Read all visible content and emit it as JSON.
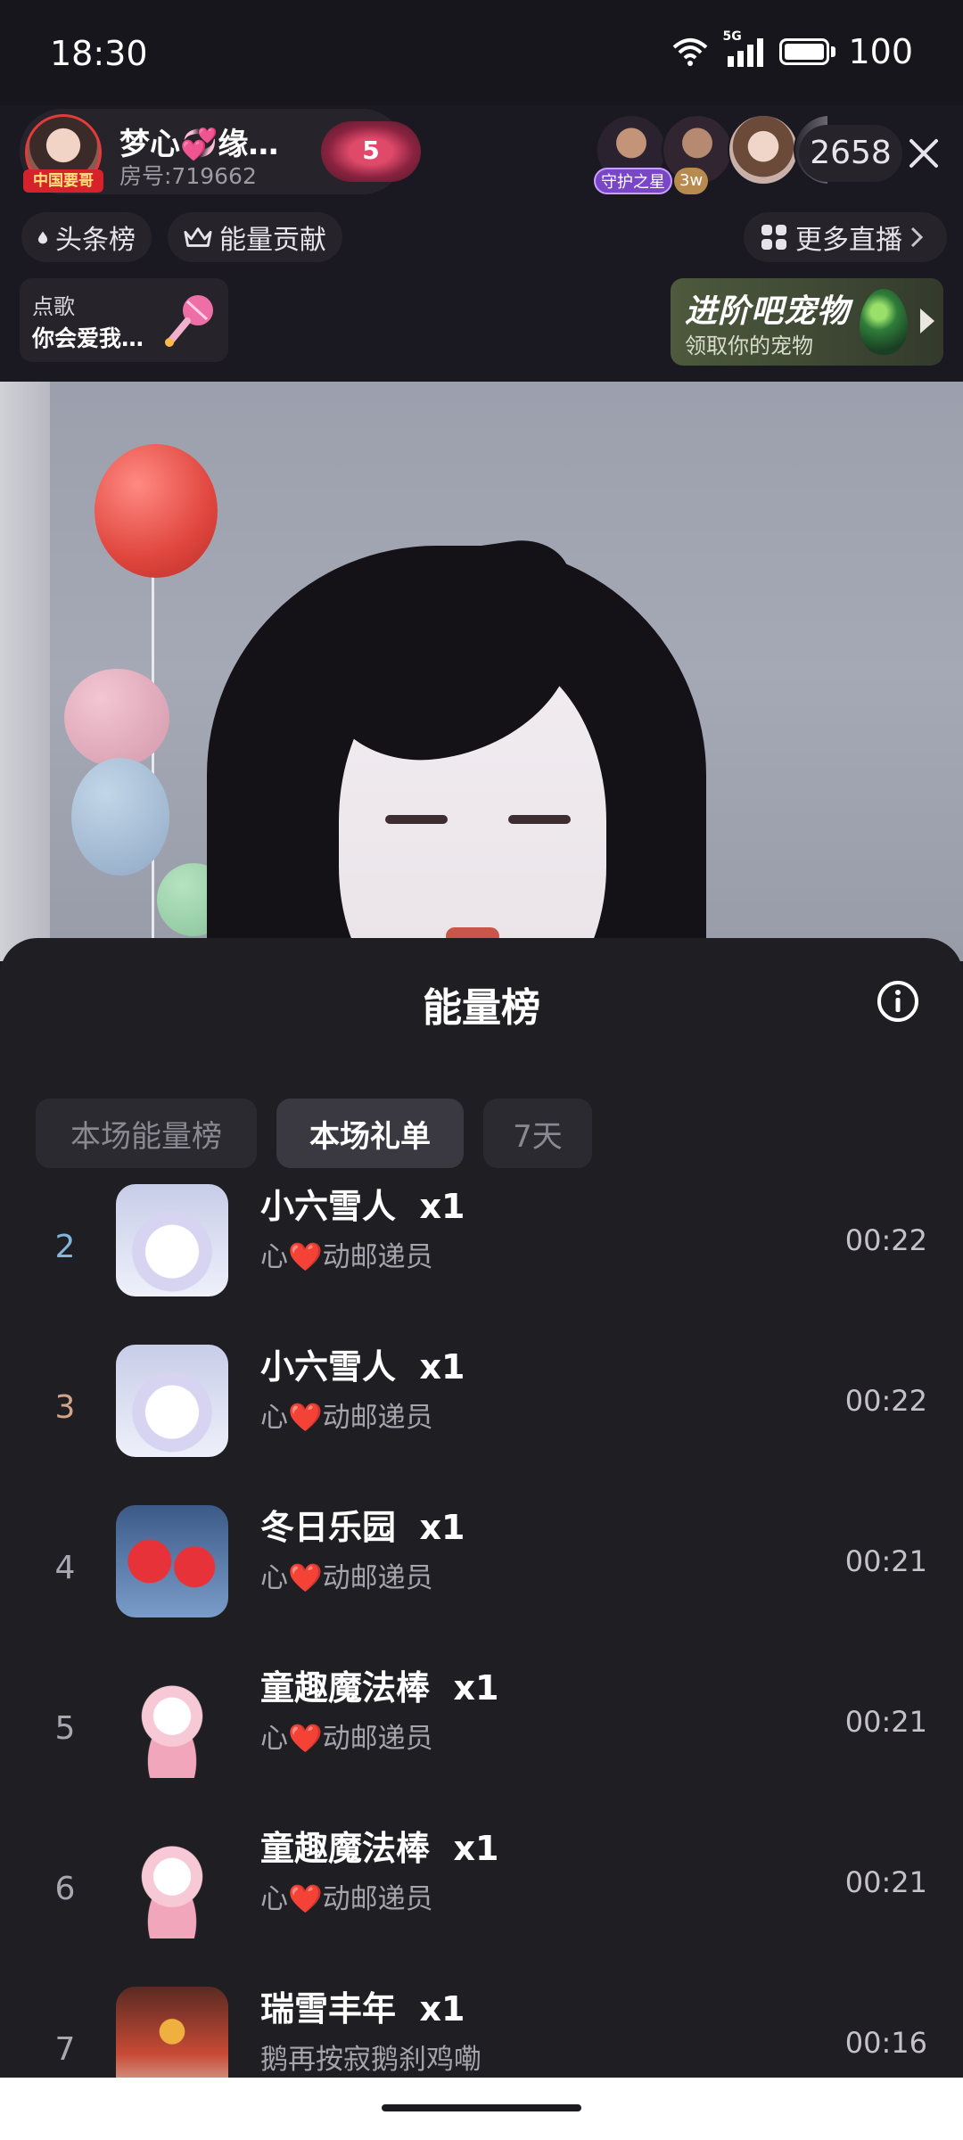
{
  "status_bar": {
    "time": "18:30",
    "battery": "100",
    "network": "5G"
  },
  "header": {
    "host_name": "梦心💞缘…",
    "room_id": "房号:719662",
    "avatar_tag": "中国要哥",
    "level": "5",
    "viewer_tags": [
      "守护之星",
      "3w"
    ],
    "viewer_count": "2658"
  },
  "pills": {
    "headline": "头条榜",
    "energy": "能量贡献",
    "more": "更多直播"
  },
  "song_card": {
    "label": "点歌",
    "title": "你会爱我…"
  },
  "pet_card": {
    "title": "进阶吧宠物",
    "subtitle": "领取你的宠物"
  },
  "sheet": {
    "title": "能量榜",
    "tabs": [
      "本场能量榜",
      "本场礼单",
      "7天"
    ],
    "active_tab": "本场礼单",
    "rows": [
      {
        "rank": "2",
        "gift": "小六雪人",
        "qty": "x1",
        "sender": "心❤️动邮递员",
        "time": "00:22"
      },
      {
        "rank": "3",
        "gift": "小六雪人",
        "qty": "x1",
        "sender": "心❤️动邮递员",
        "time": "00:22"
      },
      {
        "rank": "4",
        "gift": "冬日乐园",
        "qty": "x1",
        "sender": "心❤️动邮递员",
        "time": "00:21"
      },
      {
        "rank": "5",
        "gift": "童趣魔法棒",
        "qty": "x1",
        "sender": "心❤️动邮递员",
        "time": "00:21"
      },
      {
        "rank": "6",
        "gift": "童趣魔法棒",
        "qty": "x1",
        "sender": "心❤️动邮递员",
        "time": "00:21"
      },
      {
        "rank": "7",
        "gift": "瑞雪丰年",
        "qty": "x1",
        "sender": "鹅再按寂鹅刹鸡嘞",
        "time": "00:16"
      }
    ]
  }
}
